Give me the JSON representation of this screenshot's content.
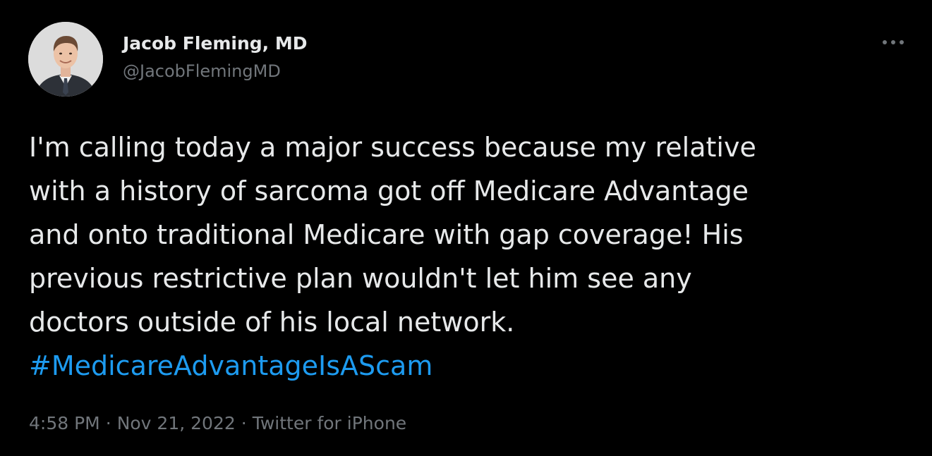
{
  "author": {
    "display_name": "Jacob Fleming, MD",
    "handle": "@JacobFlemingMD",
    "avatar_icon": "profile-photo"
  },
  "more_icon": "more-dots-icon",
  "tweet": {
    "lines": [
      "I'm calling today a major success because my relative",
      "with a history of sarcoma got off Medicare Advantage",
      "and onto traditional Medicare with gap coverage! His",
      "previous restrictive plan wouldn't let him see any",
      "doctors outside of his local network."
    ],
    "hashtag": "#MedicareAdvantageIsAScam"
  },
  "meta": {
    "time": "4:58 PM",
    "separator": "·",
    "date": "Nov 21, 2022",
    "source": "Twitter for iPhone"
  },
  "colors": {
    "background": "#000000",
    "text": "#e7e9ea",
    "secondary": "#71767b",
    "link": "#1d9bf0"
  }
}
